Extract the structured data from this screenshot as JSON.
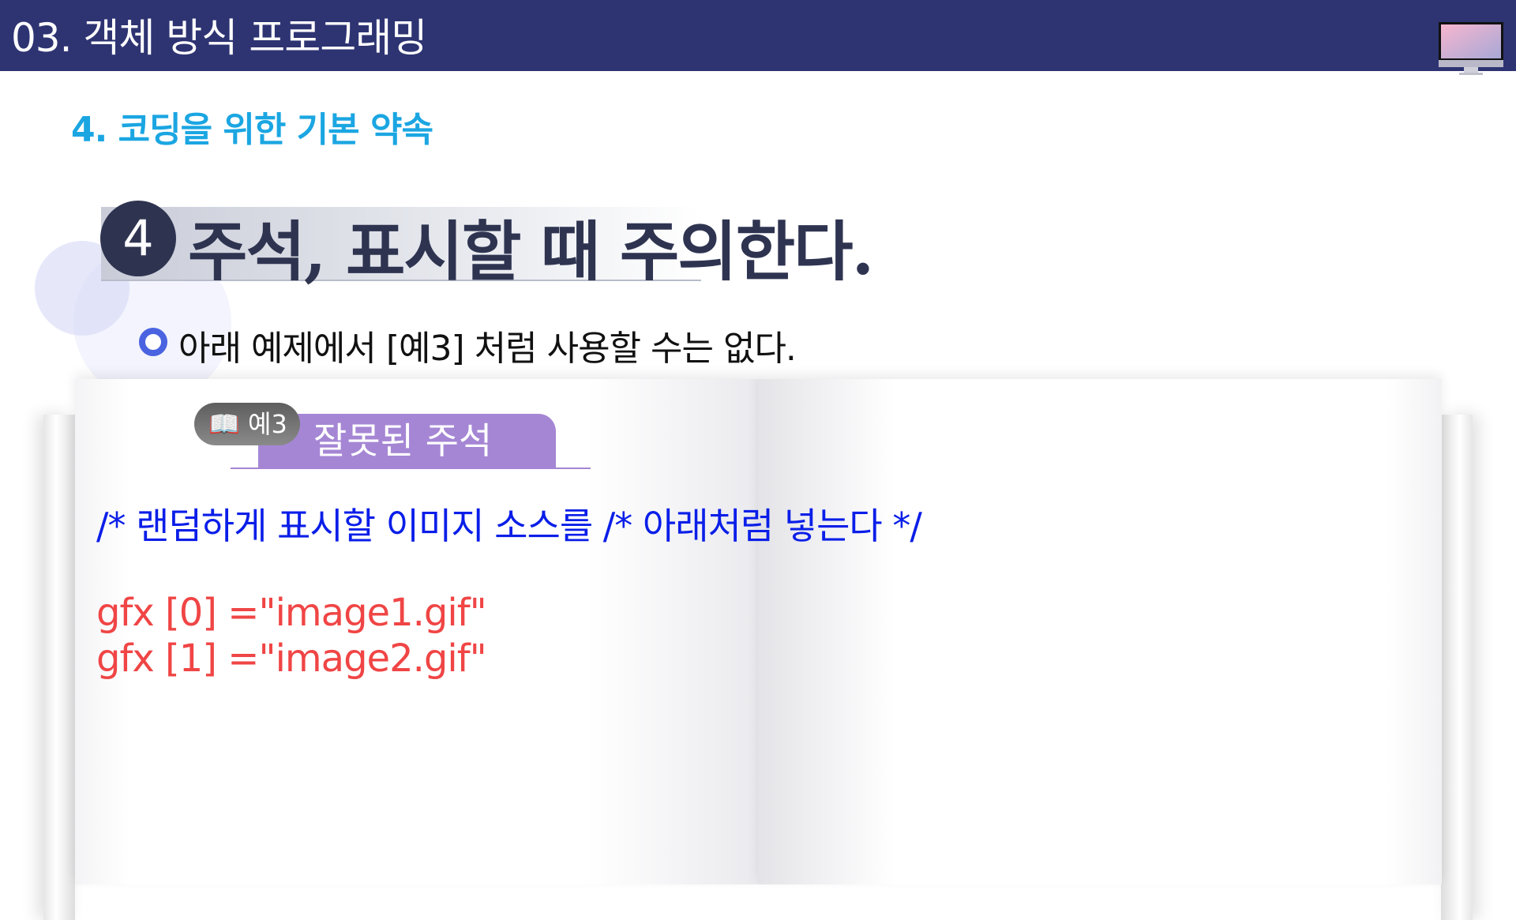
{
  "header": {
    "title": "03. 객체 방식 프로그래밍",
    "icon": "monitor-icon"
  },
  "subtitle": "4. 코딩을 위한 기본 약속",
  "section": {
    "number": "4",
    "title": "주석, 표시할 때 주의한다."
  },
  "bullet": "아래 예제에서  [예3] 처럼 사용할 수는 없다.",
  "example": {
    "tag": "예3",
    "title": "잘못된 주석",
    "icon": "book-icon"
  },
  "code": {
    "comment": "/* 랜덤하게 표시할 이미지 소스를 /* 아래처럼 넣는다 */",
    "lines": [
      "gfx [0] =\"image1.gif\"",
      "gfx [1] =\"image2.gif\""
    ]
  },
  "colors": {
    "header": "#2e3472",
    "subtitle": "#1ba6e2",
    "comment": "#0a1ee8",
    "code": "#f04545",
    "label": "#a586d4"
  }
}
